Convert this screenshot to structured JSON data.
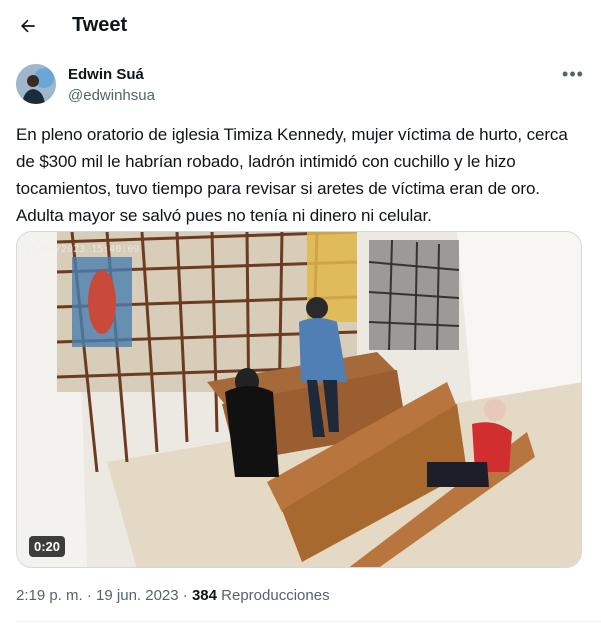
{
  "header": {
    "title": "Tweet",
    "back_icon": "arrow-left-icon"
  },
  "author": {
    "name": "Edwin Suá",
    "handle": "@edwinhsua"
  },
  "tweet": {
    "text": "En pleno oratorio de iglesia Timiza Kennedy, mujer víctima de hurto, cerca de $300 mil le habrían robado, ladrón intimidó con cuchillo y le hizo tocamientos, tuvo tiempo para revisar si aretes de víctima eran de oro. Adulta mayor se salvó pues no tenía ni dinero ni celular.",
    "media": {
      "timestamp": "15/06/2023 15:40:09",
      "duration": "0:20"
    }
  },
  "meta": {
    "time": "2:19 p. m.",
    "sep1": " · ",
    "date": "19 jun. 2023",
    "sep2": " · ",
    "views": "384",
    "views_label": " Reproducciones"
  },
  "colors": {
    "text": "#0f1419",
    "secondary": "#536471",
    "border": "#cfd9de"
  },
  "icons": {
    "more": "more-horizontal-icon"
  }
}
